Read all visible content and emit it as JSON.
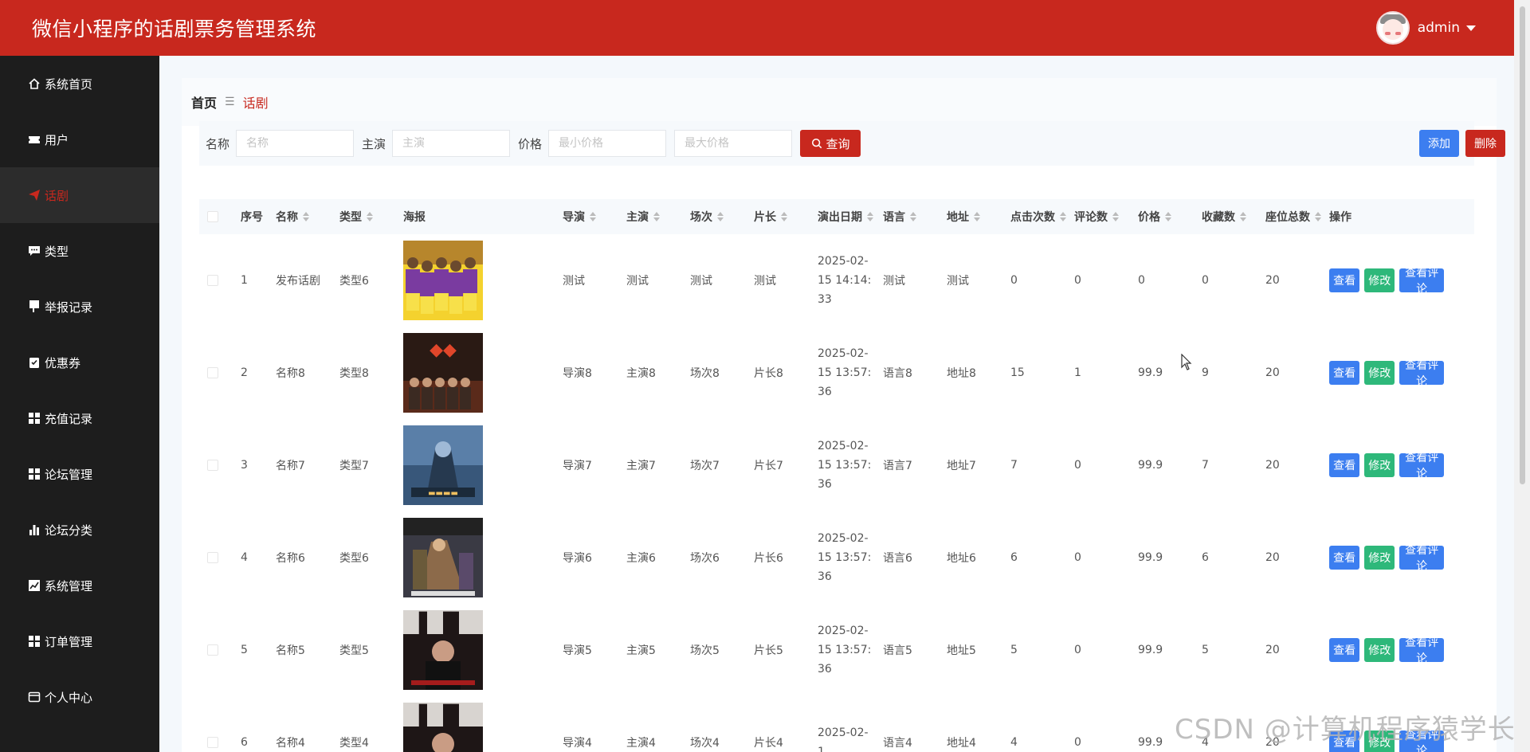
{
  "header": {
    "title": "微信小程序的话剧票务管理系统",
    "username": "admin"
  },
  "sidebar": {
    "items": [
      {
        "label": "系统首页",
        "icon": "home-icon"
      },
      {
        "label": "用户",
        "icon": "ticket-icon"
      },
      {
        "label": "话剧",
        "icon": "send-icon",
        "active": true
      },
      {
        "label": "类型",
        "icon": "comment-icon"
      },
      {
        "label": "举报记录",
        "icon": "flag-icon"
      },
      {
        "label": "优惠券",
        "icon": "clipboard-icon"
      },
      {
        "label": "充值记录",
        "icon": "grid-icon"
      },
      {
        "label": "论坛管理",
        "icon": "grid-icon"
      },
      {
        "label": "论坛分类",
        "icon": "bar-chart-icon"
      },
      {
        "label": "系统管理",
        "icon": "line-chart-icon"
      },
      {
        "label": "订单管理",
        "icon": "grid-icon"
      },
      {
        "label": "个人中心",
        "icon": "card-icon"
      }
    ]
  },
  "breadcrumb": {
    "home": "首页",
    "current": "话剧"
  },
  "search": {
    "name_label": "名称",
    "name_placeholder": "名称",
    "actor_label": "主演",
    "actor_placeholder": "主演",
    "price_label": "价格",
    "min_price_placeholder": "最小价格",
    "max_price_placeholder": "最大价格",
    "query_label": "查询",
    "add_label": "添加",
    "delete_label": "删除"
  },
  "table": {
    "headers": [
      "序号",
      "名称",
      "类型",
      "海报",
      "导演",
      "主演",
      "场次",
      "片长",
      "演出日期",
      "语言",
      "地址",
      "点击次数",
      "评论数",
      "价格",
      "收藏数",
      "座位总数",
      "操作"
    ],
    "actions": {
      "view": "查看",
      "edit": "修改",
      "comments": "查看评论"
    },
    "rows": [
      {
        "no": "1",
        "name": "发布话剧",
        "type": "类型6",
        "director": "测试",
        "actor": "测试",
        "session": "测试",
        "duration": "测试",
        "date": "2025-02-15 14:14:33",
        "language": "测试",
        "address": "测试",
        "clicks": "0",
        "comments": "0",
        "price": "0",
        "favorites": "0",
        "seats": "20",
        "poster": "team-photo"
      },
      {
        "no": "2",
        "name": "名称8",
        "type": "类型8",
        "director": "导演8",
        "actor": "主演8",
        "session": "场次8",
        "duration": "片长8",
        "date": "2025-02-15 13:57:36",
        "language": "语言8",
        "address": "地址8",
        "clicks": "15",
        "comments": "1",
        "price": "99.9",
        "favorites": "9",
        "seats": "20",
        "poster": "dark-poster"
      },
      {
        "no": "3",
        "name": "名称7",
        "type": "类型7",
        "director": "导演7",
        "actor": "主演7",
        "session": "场次7",
        "duration": "片长7",
        "date": "2025-02-15 13:57:36",
        "language": "语言7",
        "address": "地址7",
        "clicks": "7",
        "comments": "0",
        "price": "99.9",
        "favorites": "7",
        "seats": "20",
        "poster": "robot-poster"
      },
      {
        "no": "4",
        "name": "名称6",
        "type": "类型6",
        "director": "导演6",
        "actor": "主演6",
        "session": "场次6",
        "duration": "片长6",
        "date": "2025-02-15 13:57:36",
        "language": "语言6",
        "address": "地址6",
        "clicks": "6",
        "comments": "0",
        "price": "99.9",
        "favorites": "6",
        "seats": "20",
        "poster": "comedy-poster"
      },
      {
        "no": "5",
        "name": "名称5",
        "type": "类型5",
        "director": "导演5",
        "actor": "主演5",
        "session": "场次5",
        "duration": "片长5",
        "date": "2025-02-15 13:57:36",
        "language": "语言5",
        "address": "地址5",
        "clicks": "5",
        "comments": "0",
        "price": "99.9",
        "favorites": "5",
        "seats": "20",
        "poster": "red-poster"
      },
      {
        "no": "6",
        "name": "名称4",
        "type": "类型4",
        "director": "导演4",
        "actor": "主演4",
        "session": "场次4",
        "duration": "片长4",
        "date": "2025-02-1",
        "language": "语言4",
        "address": "地址4",
        "clicks": "4",
        "comments": "0",
        "price": "99.9",
        "favorites": "4",
        "seats": "20",
        "poster": "red-poster"
      }
    ]
  },
  "watermark": "CSDN @计算机程序猿学长",
  "colors": {
    "brand": "#c8281e",
    "primary": "#3c7ef0",
    "success": "#2eb87a",
    "sidebar": "#1d1d1d"
  }
}
